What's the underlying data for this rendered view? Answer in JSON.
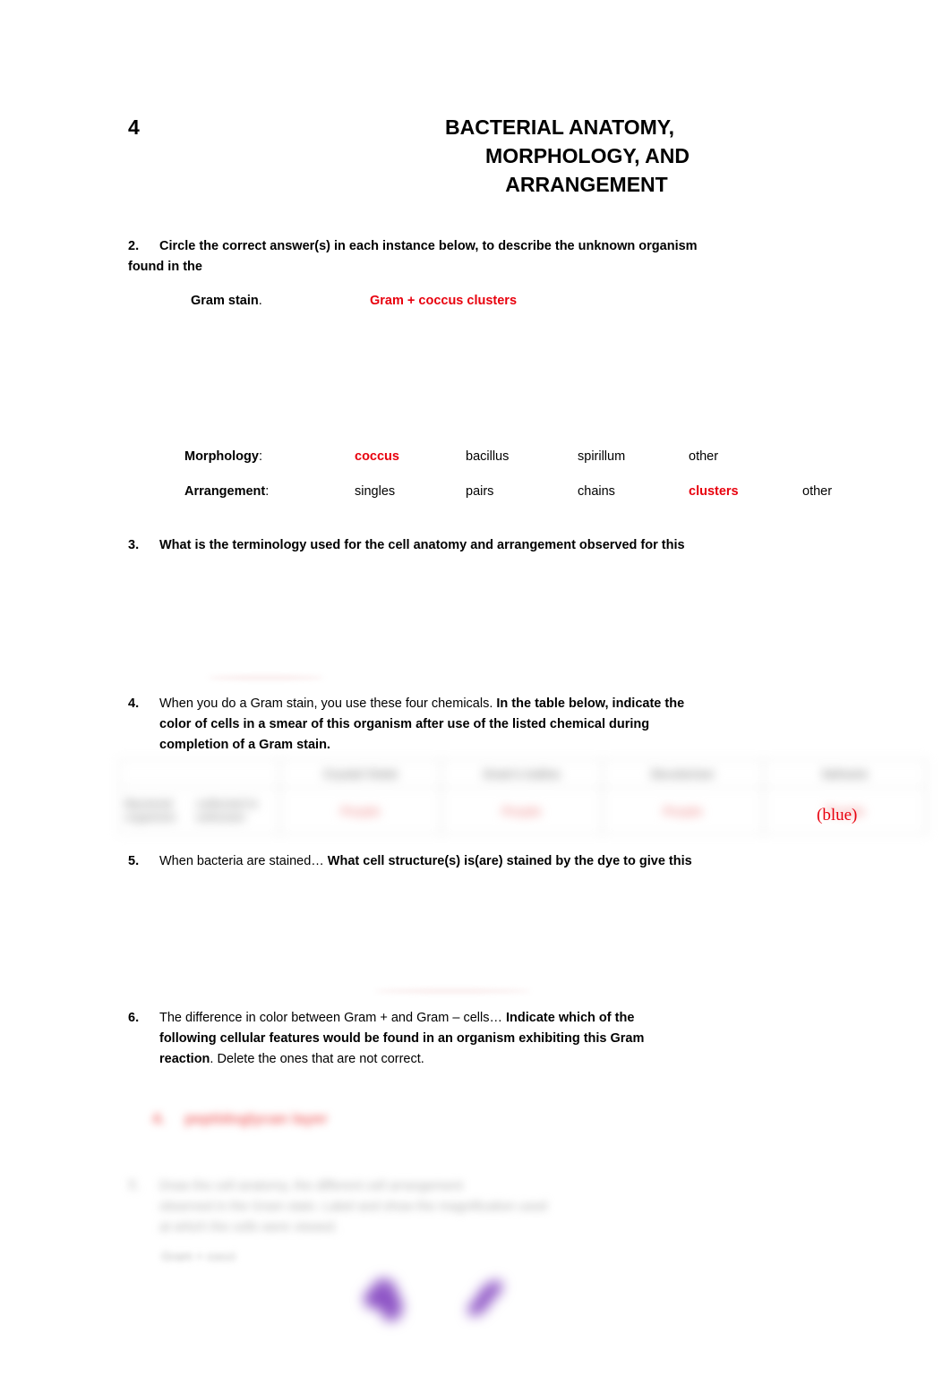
{
  "document": {
    "chapter_number": "4",
    "title_lines": [
      "BACTERIAL ANATOMY,",
      "MORPHOLOGY, AND",
      "ARRANGEMENT"
    ]
  },
  "questions": {
    "q2": {
      "number": "2.",
      "text_line1": "Circle the correct answer(s) in each instance below, to describe the unknown organism",
      "text_line2": "found in the",
      "label": "Gram stain",
      "label_suffix": ".",
      "answer": "Gram + coccus clusters"
    },
    "q3": {
      "number": "3.",
      "text": "What is the terminology used for the cell anatomy and arrangement observed for this"
    },
    "q4": {
      "number": "4.",
      "text_normal": "When you do a Gram stain, you use these four chemicals.",
      "text_bold_line1": "In the table below, indicate the",
      "text_bold_line2": "color of cells",
      "text_line2_rest": "in a smear of this organism after use of the listed chemical during",
      "text_line3": "completion of a Gram stain."
    },
    "q5": {
      "number": "5.",
      "text_normal": "When bacteria are stained…",
      "text_bold": "What cell structure(s) is(are) stained by the dye to give this"
    },
    "q6": {
      "number": "6.",
      "text_normal_1": "The difference in color between Gram + and Gram – cells…",
      "text_bold_1": "Indicate which of the",
      "text_bold_2": "following cellular features would be found in an organism exhibiting this Gram",
      "text_bold_3": "reaction",
      "text_normal_2": ".  Delete the ones that are not correct."
    },
    "q7_blurred": {
      "number": "7.",
      "line1": "Draw the cell anatomy, the different cell arrangement",
      "line2": "observed in the Gram stain. Label and show the magnification used",
      "line3": "at which the cells were viewed.",
      "caption": "Gram + cocci"
    }
  },
  "morphology_section": {
    "rows": [
      {
        "label": "Morphology",
        "label_suffix": ":",
        "options": [
          "coccus",
          "bacillus",
          "spirillum",
          "other"
        ],
        "selected": [
          "coccus"
        ]
      },
      {
        "label": "Arrangement",
        "label_suffix": ":",
        "options": [
          "singles",
          "pairs",
          "chains",
          "clusters",
          "other"
        ],
        "selected": [
          "clusters"
        ]
      }
    ]
  },
  "gram_table": {
    "headers": [
      "",
      "Crystal Violet",
      "Gram's Iodine",
      "Decolorizer",
      "Safranin"
    ],
    "row_label_line1": "Bacterial organism",
    "row_label_line2": "collected in unknown",
    "values": [
      "Purple",
      "Purple",
      "Purple",
      "Purple"
    ],
    "annotation": "(blue)"
  },
  "q6_answer_blurred": {
    "marker": "4.",
    "text": "peptidoglycan layer"
  },
  "colors": {
    "answer_red": "#e8000d",
    "annotation_red": "#e8000d",
    "blurred_red": "#f27575",
    "cell_purple": "#8a4fc4",
    "body_text": "#000000"
  }
}
